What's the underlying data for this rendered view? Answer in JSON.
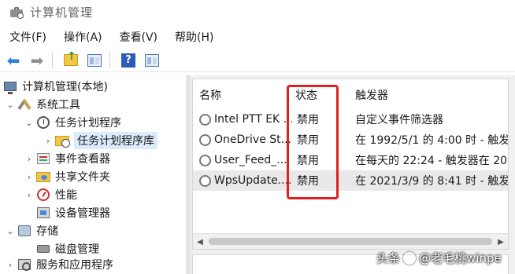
{
  "window": {
    "title": "计算机管理"
  },
  "menu": [
    "文件(F)",
    "操作(A)",
    "查看(V)",
    "帮助(H)"
  ],
  "toolbar": [
    {
      "icon": "back-arrow-icon"
    },
    {
      "icon": "forward-arrow-icon"
    },
    {
      "icon": "up-folder-icon"
    },
    {
      "icon": "show-hide-console-tree-icon"
    },
    {
      "icon": "help-icon"
    },
    {
      "icon": "action-pane-icon"
    }
  ],
  "tree": [
    {
      "label": "计算机管理(本地)",
      "icon": "computer-icon",
      "expander": "",
      "selected": false
    },
    {
      "label": "系统工具",
      "icon": "tools-icon",
      "expander": "expanded",
      "selected": false
    },
    {
      "label": "任务计划程序",
      "icon": "clock-icon",
      "expander": "expanded",
      "selected": false
    },
    {
      "label": "任务计划程序库",
      "icon": "folder-clock-icon",
      "expander": "collapsed",
      "selected": true
    },
    {
      "label": "事件查看器",
      "icon": "event-viewer-icon",
      "expander": "collapsed",
      "selected": false
    },
    {
      "label": "共享文件夹",
      "icon": "shared-folder-icon",
      "expander": "collapsed",
      "selected": false
    },
    {
      "label": "性能",
      "icon": "performance-icon",
      "expander": "collapsed",
      "selected": false
    },
    {
      "label": "设备管理器",
      "icon": "device-manager-icon",
      "expander": "",
      "selected": false
    },
    {
      "label": "存储",
      "icon": "storage-icon",
      "expander": "expanded",
      "selected": false
    },
    {
      "label": "磁盘管理",
      "icon": "disk-icon",
      "expander": "",
      "selected": false
    },
    {
      "label": "服务和应用程序",
      "icon": "services-icon",
      "expander": "collapsed",
      "selected": false
    }
  ],
  "list": {
    "columns": [
      "名称",
      "状态",
      "触发器"
    ],
    "rows": [
      {
        "name": "Intel PTT EK ...",
        "status": "禁用",
        "trigger": "自定义事件筛选器",
        "selected": false
      },
      {
        "name": "OneDrive St...",
        "status": "禁用",
        "trigger": "在 1992/5/1 的 4:00 时 - 触发",
        "selected": false
      },
      {
        "name": "User_Feed_...",
        "status": "禁用",
        "trigger": "在每天的 22:24 - 触发器在 20",
        "selected": false
      },
      {
        "name": "WpsUpdate....",
        "status": "禁用",
        "trigger": "在 2021/3/9 的 8:41 时 - 触发",
        "selected": true
      }
    ]
  },
  "watermark": {
    "text_before": "头条",
    "text_after": "@老毛桃winpe"
  },
  "colors": {
    "highlight": "#e02020",
    "selection": "#dcebfa",
    "accent": "#2f7fd8"
  }
}
